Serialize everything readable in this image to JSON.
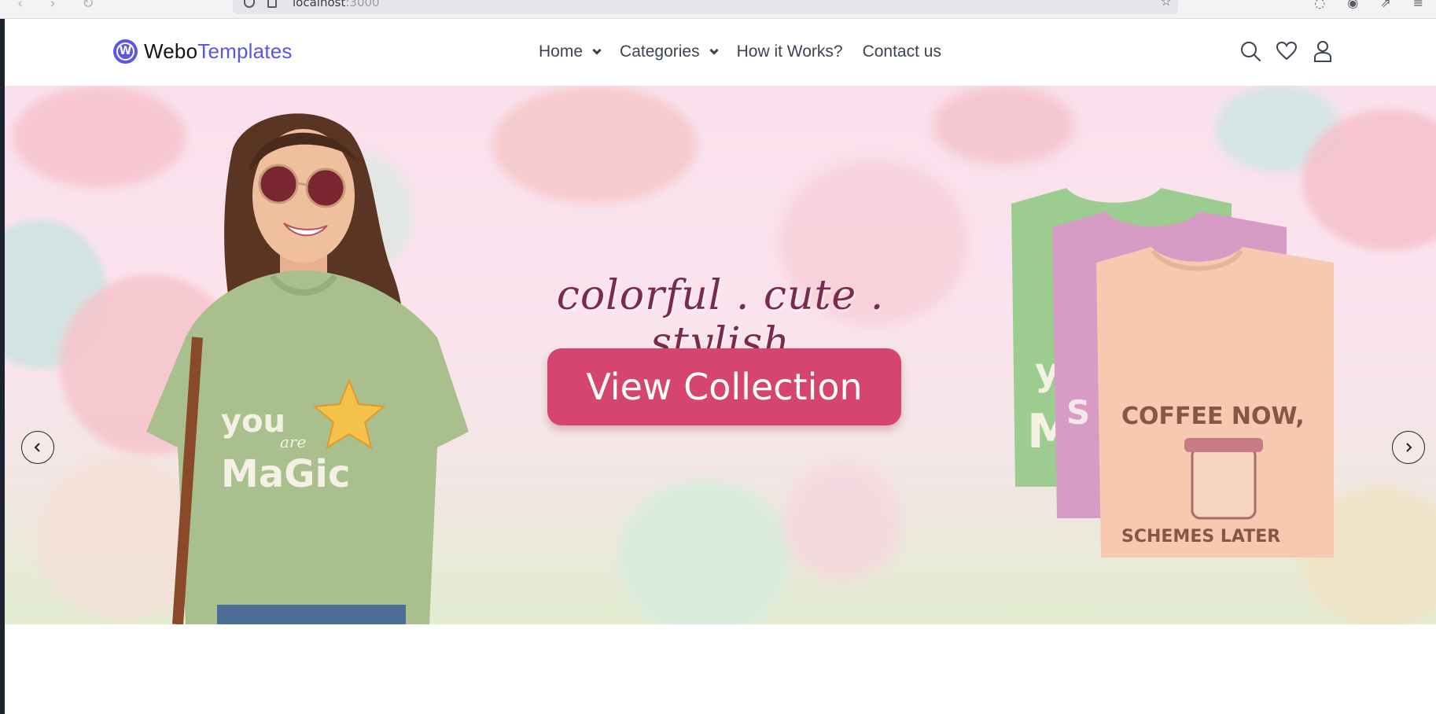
{
  "browser": {
    "url_host": "localhost",
    "url_port": ":3000"
  },
  "header": {
    "logo": {
      "part1": "Webo",
      "part2": "Templates",
      "badge_letter": "W"
    },
    "nav": [
      {
        "label": "Home",
        "has_dropdown": true
      },
      {
        "label": "Categories",
        "has_dropdown": true
      },
      {
        "label": "How it Works?",
        "has_dropdown": false
      },
      {
        "label": "Contact us",
        "has_dropdown": false
      }
    ],
    "icons": [
      "search-icon",
      "heart-icon",
      "user-icon"
    ]
  },
  "hero": {
    "tagline": "colorful . cute . stylish",
    "cta_label": "View Collection",
    "shirt_left_text_1": "you",
    "shirt_left_text_2": "are",
    "shirt_left_text_3": "MaGic",
    "shirt_front_text_1": "COFFEE NOW,",
    "shirt_front_text_2": "SCHEMES LATER",
    "prev_icon": "chevron-left-icon",
    "next_icon": "chevron-right-icon"
  },
  "colors": {
    "brand": "#5b56e6",
    "cta": "#d5456f",
    "tagline": "#7a2a4c",
    "nav_text": "#3b4452"
  }
}
